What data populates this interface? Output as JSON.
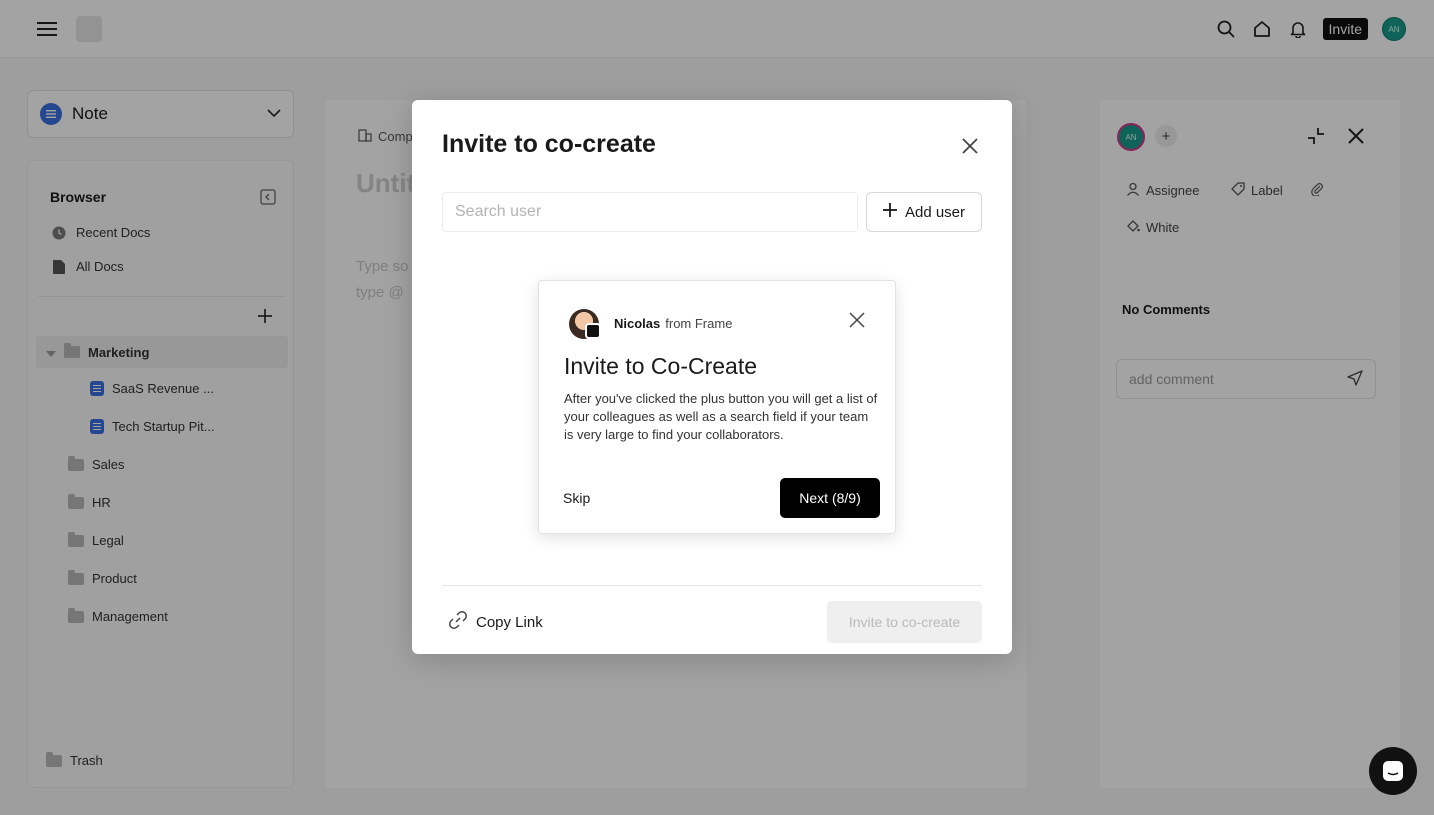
{
  "topbar": {
    "invite_label": "Invite",
    "avatar_initials": "AN"
  },
  "sidebar": {
    "note_select_label": "Note",
    "browser_title": "Browser",
    "recent_docs": "Recent Docs",
    "all_docs": "All Docs",
    "folders": [
      {
        "label": "Marketing"
      },
      {
        "label": "SaaS Revenue ..."
      },
      {
        "label": "Tech Startup Pit..."
      },
      {
        "label": "Sales"
      },
      {
        "label": "HR"
      },
      {
        "label": "Legal"
      },
      {
        "label": "Product"
      },
      {
        "label": "Management"
      }
    ],
    "trash": "Trash"
  },
  "doc": {
    "breadcrumb": "Comp",
    "title": "Untit",
    "placeholder_line1": "Type so",
    "placeholder_line2": "type @"
  },
  "right_panel": {
    "avatar_initials": "AN",
    "assignee": "Assignee",
    "label": "Label",
    "color": "White",
    "no_comments": "No Comments",
    "comment_placeholder": "add comment"
  },
  "modal": {
    "title": "Invite to co-create",
    "search_placeholder": "Search user",
    "add_user_label": "Add user",
    "copy_link_label": "Copy Link",
    "invite_button_label": "Invite to co-create"
  },
  "tour": {
    "sender_name": "Nicolas",
    "sender_from": "from Frame",
    "title": "Invite to Co-Create",
    "body": "After you've clicked the plus button you will get a list of your colleagues as well as a search field if your team is very large to find your collaborators.",
    "skip_label": "Skip",
    "next_label": "Next (8/9)"
  },
  "colors": {
    "accent_blue": "#3a6fe0",
    "avatar_teal": "#1a9b8a",
    "primary_black": "#000000"
  }
}
